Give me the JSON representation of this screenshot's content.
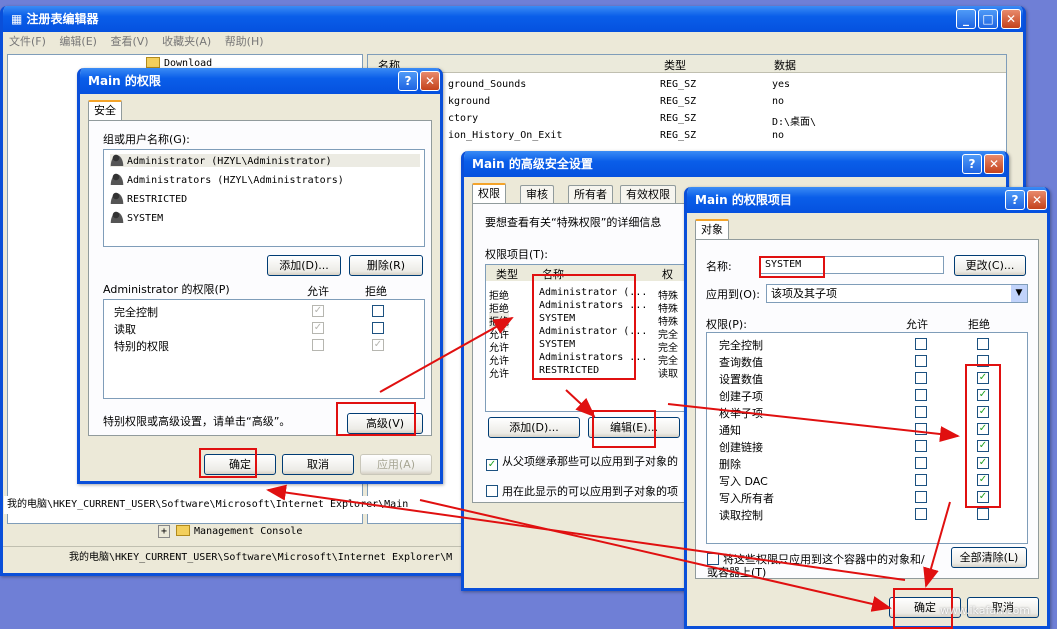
{
  "regedit": {
    "title": "注册表编辑器",
    "menu": [
      "文件(F)",
      "编辑(E)",
      "查看(V)",
      "收藏夹(A)",
      "帮助(H)"
    ],
    "tree_top_item": "Download",
    "tree_items": [
      "Management Console"
    ],
    "columns": [
      "名称",
      "类型",
      "数据"
    ],
    "rows": [
      {
        "name": "ground_Sounds",
        "type": "REG_SZ",
        "data": "yes"
      },
      {
        "name": "kground",
        "type": "REG_SZ",
        "data": "no"
      },
      {
        "name": "ctory",
        "type": "REG_SZ",
        "data": "D:\\桌面\\"
      },
      {
        "name": "ion_History_On_Exit",
        "type": "REG_SZ",
        "data": "no"
      }
    ],
    "status": "我的电脑\\HKEY_CURRENT_USER\\Software\\Microsoft\\Internet Explorer\\Main",
    "status2": "我的电脑\\HKEY_CURRENT_USER\\Software\\Microsoft\\Internet Explorer\\M"
  },
  "perm_dialog": {
    "title": "Main 的权限",
    "tab": "安全",
    "group_label": "组或用户名称(G):",
    "users": [
      "Administrator (HZYL\\Administrator)",
      "Administrators (HZYL\\Administrators)",
      "RESTRICTED",
      "SYSTEM"
    ],
    "add": "添加(D)...",
    "remove": "删除(R)",
    "perm_for": "Administrator 的权限(P)",
    "allow": "允许",
    "deny": "拒绝",
    "perms": [
      {
        "label": "完全控制",
        "allow": true,
        "deny": false
      },
      {
        "label": "读取",
        "allow": true,
        "deny": false
      },
      {
        "label": "特别的权限",
        "allow": false,
        "deny": true
      }
    ],
    "advanced_hint": "特别权限或高级设置，请单击“高级”。",
    "advanced": "高级(V)",
    "ok": "确定",
    "cancel": "取消",
    "apply": "应用(A)"
  },
  "adv_dialog": {
    "title": "Main 的高级安全设置",
    "tabs": [
      "权限",
      "审核",
      "所有者",
      "有效权限"
    ],
    "intro": "要想查看有关“特殊权限”的详细信息",
    "entries_label": "权限项目(T):",
    "cols": [
      "类型",
      "名称",
      "权"
    ],
    "entries": [
      {
        "type": "拒绝",
        "name": "Administrator (...",
        "perm": "特殊"
      },
      {
        "type": "拒绝",
        "name": "Administrators ...",
        "perm": "特殊"
      },
      {
        "type": "拒绝",
        "name": "SYSTEM",
        "perm": "特殊"
      },
      {
        "type": "允许",
        "name": "Administrator (...",
        "perm": "完全"
      },
      {
        "type": "允许",
        "name": "SYSTEM",
        "perm": "完全"
      },
      {
        "type": "允许",
        "name": "Administrators ...",
        "perm": "完全"
      },
      {
        "type": "允许",
        "name": "RESTRICTED",
        "perm": "读取"
      }
    ],
    "add": "添加(D)...",
    "edit": "编辑(E)...",
    "inherit": "从父项继承那些可以应用到子对象的",
    "replace": "用在此显示的可以应用到子对象的项"
  },
  "entry_dialog": {
    "title": "Main 的权限项目",
    "tab": "对象",
    "name_label": "名称:",
    "name_value": "SYSTEM",
    "change": "更改(C)...",
    "apply_to_label": "应用到(O):",
    "apply_to_value": "该项及其子项",
    "perm_label": "权限(P):",
    "allow": "允许",
    "deny": "拒绝",
    "perms": [
      {
        "label": "完全控制",
        "deny": false
      },
      {
        "label": "查询数值",
        "deny": false
      },
      {
        "label": "设置数值",
        "deny": true
      },
      {
        "label": "创建子项",
        "deny": true
      },
      {
        "label": "枚举子项",
        "deny": true
      },
      {
        "label": "通知",
        "deny": true
      },
      {
        "label": "创建链接",
        "deny": true
      },
      {
        "label": "删除",
        "deny": true
      },
      {
        "label": "写入 DAC",
        "deny": true
      },
      {
        "label": "写入所有者",
        "deny": true
      },
      {
        "label": "读取控制",
        "deny": false
      }
    ],
    "only_apply": "将这些权限只应用到这个容器中的对象和/或容器上(T)",
    "clear_all": "全部清除(L)",
    "ok": "确定",
    "cancel": "取消"
  },
  "watermark": "www.ikafan.com"
}
